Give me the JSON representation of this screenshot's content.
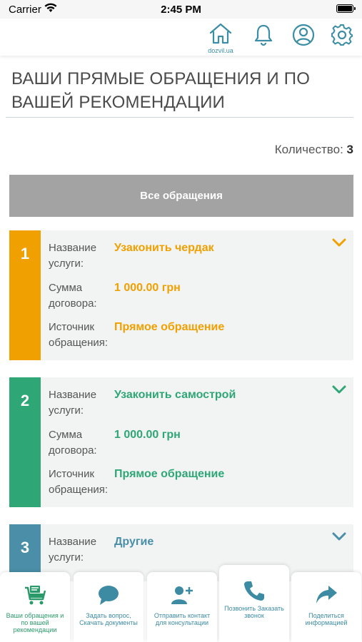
{
  "status_bar": {
    "carrier": "Carrier",
    "time": "2:45 PM"
  },
  "header": {
    "home_label": "dozvil.ua"
  },
  "page": {
    "title": "ВАШИ ПРЯМЫЕ ОБРАЩЕНИЯ И ПО ВАШЕЙ РЕКОМЕНДАЦИИ",
    "count_label": "Количество:",
    "count_value": "3",
    "all_button": "Все обращения"
  },
  "labels": {
    "service": "Название услуги:",
    "amount": "Сумма договора:",
    "source": "Источник обращения:"
  },
  "cards": [
    {
      "number": "1",
      "service": "Узаконить чердак",
      "amount": "1 000.00 грн",
      "source": "Прямое обращение",
      "color": "#f0a000"
    },
    {
      "number": "2",
      "service": "Узаконить самострой",
      "amount": "1 000.00 грн",
      "source": "Прямое обращение",
      "color": "#2fa676"
    },
    {
      "number": "3",
      "service": "Другие",
      "color": "#4a8ea7"
    }
  ],
  "tabs": [
    {
      "label": "Ваши обращения и по вашей рекомендации",
      "icon": "cart-icon"
    },
    {
      "label": "Задать вопрос, Скачать документы",
      "icon": "chat-bubble-icon"
    },
    {
      "label": "Отправить контакт для консультации",
      "icon": "add-user-icon"
    },
    {
      "label": "Позвонить Заказать звонок",
      "icon": "phone-icon"
    },
    {
      "label": "Поделиться информацией",
      "icon": "share-arrow-icon"
    }
  ]
}
